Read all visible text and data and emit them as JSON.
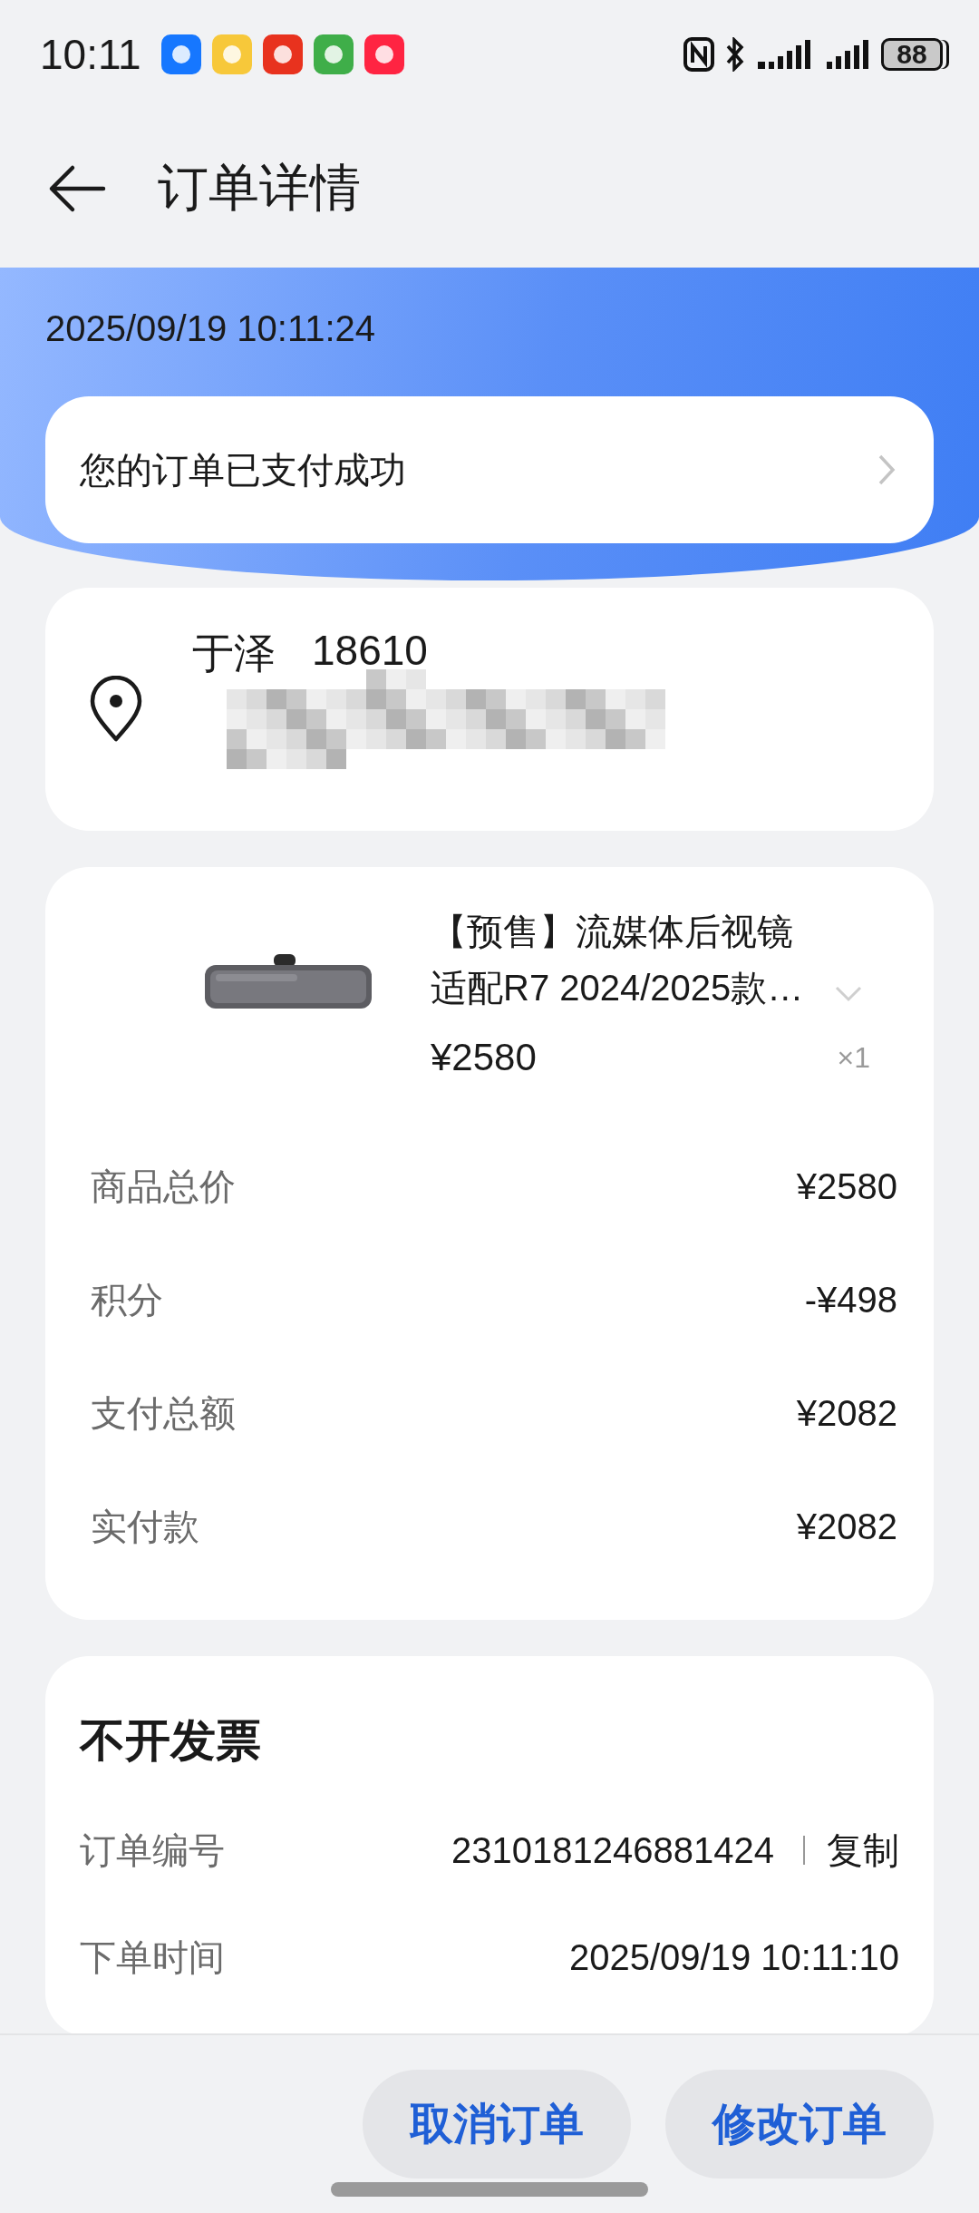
{
  "status_bar": {
    "time": "10:11",
    "battery": "88"
  },
  "header": {
    "title": "订单详情"
  },
  "status_banner": {
    "timestamp": "2025/09/19 10:11:24",
    "notice": "您的订单已支付成功"
  },
  "address": {
    "name": "于泽",
    "phone": "18610"
  },
  "product": {
    "title_lines": [
      "【预售】流媒体后视镜",
      "适配R7 2024/2025款…"
    ],
    "price": "¥2580",
    "quantity": "×1"
  },
  "summary": [
    {
      "label": "商品总价",
      "value": "¥2580"
    },
    {
      "label": "积分",
      "value": "-¥498"
    },
    {
      "label": "支付总额",
      "value": "¥2082"
    },
    {
      "label": "实付款",
      "value": "¥2082"
    }
  ],
  "invoice": {
    "title": "不开发票",
    "rows": [
      {
        "kind": "copyable",
        "label": "订单编号",
        "value": "2310181246881424",
        "action": "复制"
      },
      {
        "kind": "plain",
        "label": "下单时间",
        "value": "2025/09/19 10:11:10"
      }
    ]
  },
  "actions": [
    "取消订单",
    "修改订单"
  ]
}
